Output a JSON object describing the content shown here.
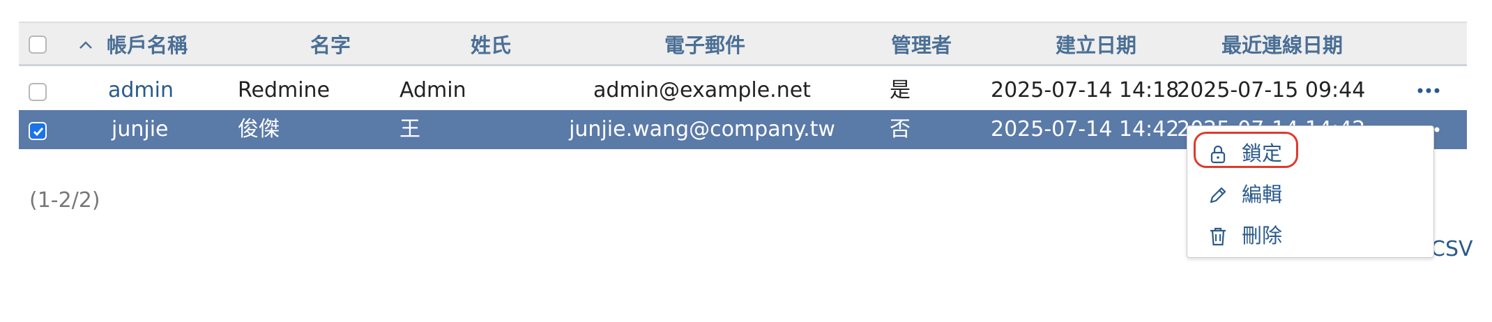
{
  "table": {
    "headers": {
      "login": "帳戶名稱",
      "firstname": "名字",
      "lastname": "姓氏",
      "email": "電子郵件",
      "admin": "管理者",
      "created": "建立日期",
      "last_login": "最近連線日期"
    },
    "sort_direction": "ascending",
    "rows": [
      {
        "selected": false,
        "login": "admin",
        "firstname": "Redmine",
        "lastname": "Admin",
        "email": "admin@example.net",
        "admin": "是",
        "created": "2025-07-14 14:18",
        "last_login": "2025-07-15 09:44"
      },
      {
        "selected": true,
        "login": "junjie",
        "firstname": "俊傑",
        "lastname": "王",
        "email": "junjie.wang@company.tw",
        "admin": "否",
        "created": "2025-07-14 14:42",
        "last_login": "2025-07-14 14:42"
      }
    ]
  },
  "pagination": "(1-2/2)",
  "export": {
    "csv_label": "CSV"
  },
  "context_menu": {
    "items": [
      {
        "label": "鎖定",
        "icon": "lock-icon",
        "highlighted": true
      },
      {
        "label": "編輯",
        "icon": "pencil-icon"
      },
      {
        "label": "刪除",
        "icon": "trash-icon"
      }
    ]
  },
  "colors": {
    "header_bg": "#eeeeee",
    "header_text": "#4a6f96",
    "link": "#2a5a8c",
    "selected_row_bg": "#5a7aa8",
    "highlight_ring": "#e0392b",
    "checkbox_checked": "#1a73e8"
  }
}
